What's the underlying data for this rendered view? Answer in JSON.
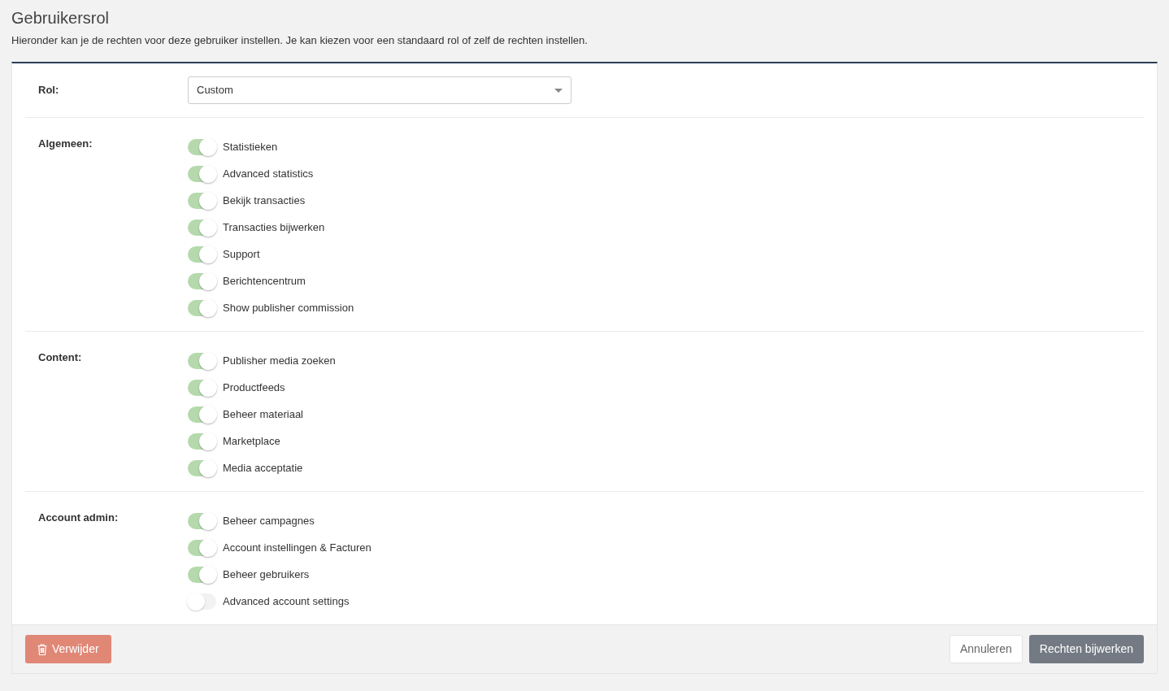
{
  "title": "Gebruikersrol",
  "description": "Hieronder kan je de rechten voor deze gebruiker instellen. Je kan kiezen voor een standaard rol of zelf de rechten instellen.",
  "role": {
    "label": "Rol:",
    "value": "Custom"
  },
  "sections": [
    {
      "label": "Algemeen:",
      "permissions": [
        {
          "label": "Statistieken",
          "on": true
        },
        {
          "label": "Advanced statistics",
          "on": true
        },
        {
          "label": "Bekijk transacties",
          "on": true
        },
        {
          "label": "Transacties bijwerken",
          "on": true
        },
        {
          "label": "Support",
          "on": true
        },
        {
          "label": "Berichtencentrum",
          "on": true
        },
        {
          "label": "Show publisher commission",
          "on": true
        }
      ]
    },
    {
      "label": "Content:",
      "permissions": [
        {
          "label": "Publisher media zoeken",
          "on": true
        },
        {
          "label": "Productfeeds",
          "on": true
        },
        {
          "label": "Beheer materiaal",
          "on": true
        },
        {
          "label": "Marketplace",
          "on": true
        },
        {
          "label": "Media acceptatie",
          "on": true
        }
      ]
    },
    {
      "label": "Account admin:",
      "permissions": [
        {
          "label": "Beheer campagnes",
          "on": true
        },
        {
          "label": "Account instellingen & Facturen",
          "on": true
        },
        {
          "label": "Beheer gebruikers",
          "on": true
        },
        {
          "label": "Advanced account settings",
          "on": false
        }
      ]
    }
  ],
  "footer": {
    "delete": "Verwijder",
    "cancel": "Annuleren",
    "submit": "Rechten bijwerken"
  }
}
